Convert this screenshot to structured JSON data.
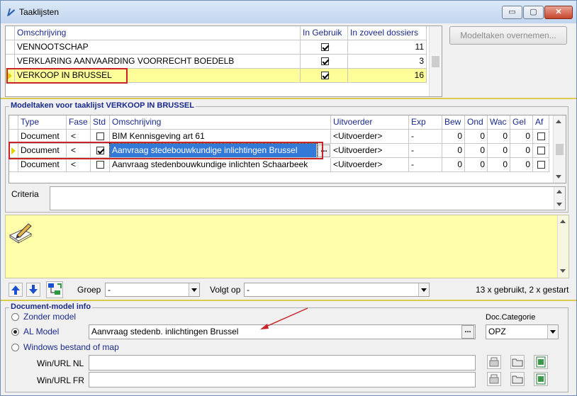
{
  "window": {
    "title": "Taaklijsten",
    "controls": {
      "minimize": "▭",
      "maximize": "▢",
      "close": "✕"
    }
  },
  "tasklists": {
    "columns": [
      "Omschrijving",
      "In Gebruik",
      "In zoveel dossiers"
    ],
    "rows": [
      {
        "description": "VENNOOTSCHAP",
        "in_use": true,
        "dossiers": "11"
      },
      {
        "description": "VERKLARING AANVAARDING VOORRECHT BOEDELB",
        "in_use": true,
        "dossiers": "3"
      },
      {
        "description": "VERKOOP IN BRUSSEL",
        "in_use": true,
        "dossiers": "16",
        "selected": true
      }
    ],
    "take_over_button": "Modeltaken overnemen..."
  },
  "modeltasks": {
    "section_title": "Modeltaken voor taaklijst VERKOOP IN BRUSSEL",
    "columns": [
      "Type",
      "Fase",
      "Std",
      "Omschrijving",
      "Uitvoerder",
      "Exp",
      "Bew",
      "Ond",
      "Wac",
      "Gel",
      "Af"
    ],
    "rows": [
      {
        "type": "Document",
        "fase": "<",
        "std": false,
        "description": "BIM Kennisgeving art 61",
        "executor": "<Uitvoerder>",
        "exp": "-",
        "bew": "0",
        "ond": "0",
        "wac": "0",
        "gel": "0",
        "af": false
      },
      {
        "type": "Document",
        "fase": "<",
        "std": true,
        "description": "Aanvraag stedebouwkundige inlichtingen Brussel",
        "executor": "<Uitvoerder>",
        "exp": "-",
        "bew": "0",
        "ond": "0",
        "wac": "0",
        "gel": "0",
        "af": false,
        "selected": true
      },
      {
        "type": "Document",
        "fase": "<",
        "std": false,
        "description": "Aanvraag stedenbouwkundige inlichten Schaarbeek",
        "executor": "<Uitvoerder>",
        "exp": "-",
        "bew": "0",
        "ond": "0",
        "wac": "0",
        "gel": "0",
        "af": false
      }
    ],
    "ellipsis": "...",
    "criteria_label": "Criteria",
    "criteria_value": ""
  },
  "toolbar": {
    "groep_label": "Groep",
    "groep_value": "-",
    "volgt_op_label": "Volgt op",
    "volgt_op_value": "-",
    "usage_text": "13 x gebruikt, 2 x gestart"
  },
  "docmodel": {
    "section_title": "Document-model info",
    "options": [
      {
        "label": "Zonder model",
        "selected": false
      },
      {
        "label": "AL Model",
        "selected": true
      },
      {
        "label": "Windows bestand of map",
        "selected": false
      }
    ],
    "al_model_value": "Aanvraag stedenb. inlichtingen Brussel",
    "doc_categorie_label": "Doc.Categorie",
    "doc_categorie_value": "OPZ",
    "win_url_nl_label": "Win/URL NL",
    "win_url_nl_value": "",
    "win_url_fr_label": "Win/URL FR",
    "win_url_fr_value": ""
  },
  "colors": {
    "highlight_row": "#ffff99",
    "memo_background": "#ffffaa",
    "annotation_red": "#c8252b",
    "selection_blue": "#3379d7"
  }
}
